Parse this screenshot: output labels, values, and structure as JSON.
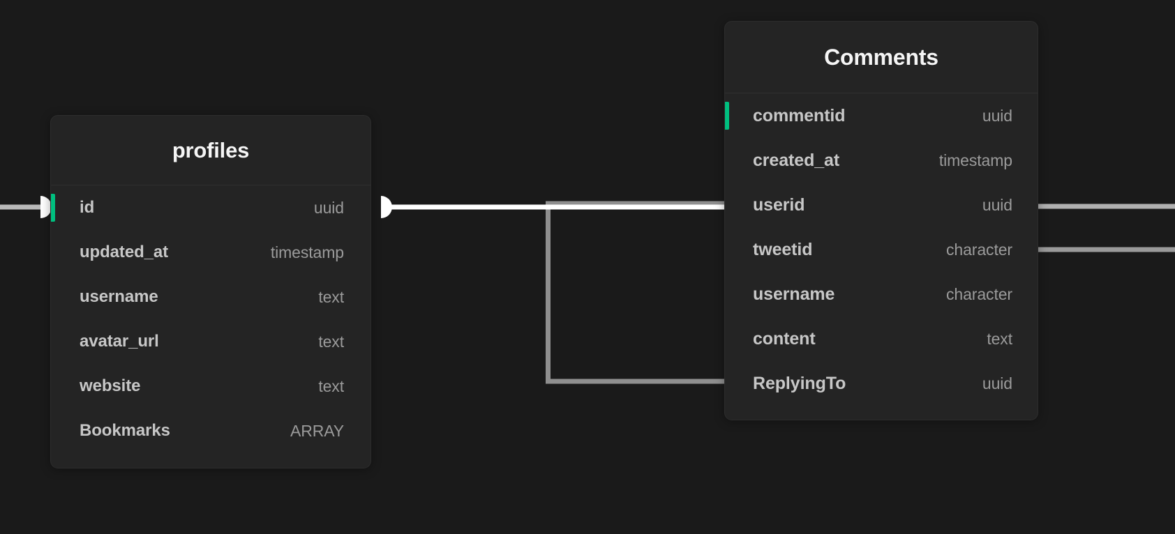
{
  "canvas": {
    "background_color": "#1a1a1a",
    "card_color": "#242424",
    "accent_color": "#00bf7f",
    "edge_color_primary": "#ffffff",
    "edge_color_secondary": "#999999"
  },
  "tables": [
    {
      "id": "profiles",
      "title": "profiles",
      "columns": [
        {
          "name": "id",
          "type": "uuid",
          "primary_key": true
        },
        {
          "name": "updated_at",
          "type": "timestamp",
          "primary_key": false
        },
        {
          "name": "username",
          "type": "text",
          "primary_key": false
        },
        {
          "name": "avatar_url",
          "type": "text",
          "primary_key": false
        },
        {
          "name": "website",
          "type": "text",
          "primary_key": false
        },
        {
          "name": "Bookmarks",
          "type": "ARRAY",
          "primary_key": false
        }
      ]
    },
    {
      "id": "comments",
      "title": "Comments",
      "columns": [
        {
          "name": "commentid",
          "type": "uuid",
          "primary_key": true
        },
        {
          "name": "created_at",
          "type": "timestamp",
          "primary_key": false
        },
        {
          "name": "userid",
          "type": "uuid",
          "primary_key": false
        },
        {
          "name": "tweetid",
          "type": "character",
          "primary_key": false
        },
        {
          "name": "username",
          "type": "character",
          "primary_key": false
        },
        {
          "name": "content",
          "type": "text",
          "primary_key": false
        },
        {
          "name": "ReplyingTo",
          "type": "uuid",
          "primary_key": false
        }
      ]
    }
  ],
  "relationships": [
    {
      "id": "rel-incoming-profiles-id",
      "from": "offscreen-left",
      "to": "profiles.id",
      "style": "primary"
    },
    {
      "id": "rel-profiles-id-right",
      "from": "profiles.id",
      "to": "comments.userid",
      "style": "primary"
    },
    {
      "id": "rel-elbow-comments",
      "from": "profiles.id",
      "to": "comments.ReplyingTo",
      "style": "secondary"
    },
    {
      "id": "rel-userid-offscreen",
      "from": "comments.userid",
      "to": "offscreen-right",
      "style": "secondary"
    },
    {
      "id": "rel-tweetid-offscreen",
      "from": "comments.tweetid",
      "to": "offscreen-right",
      "style": "secondary"
    }
  ]
}
